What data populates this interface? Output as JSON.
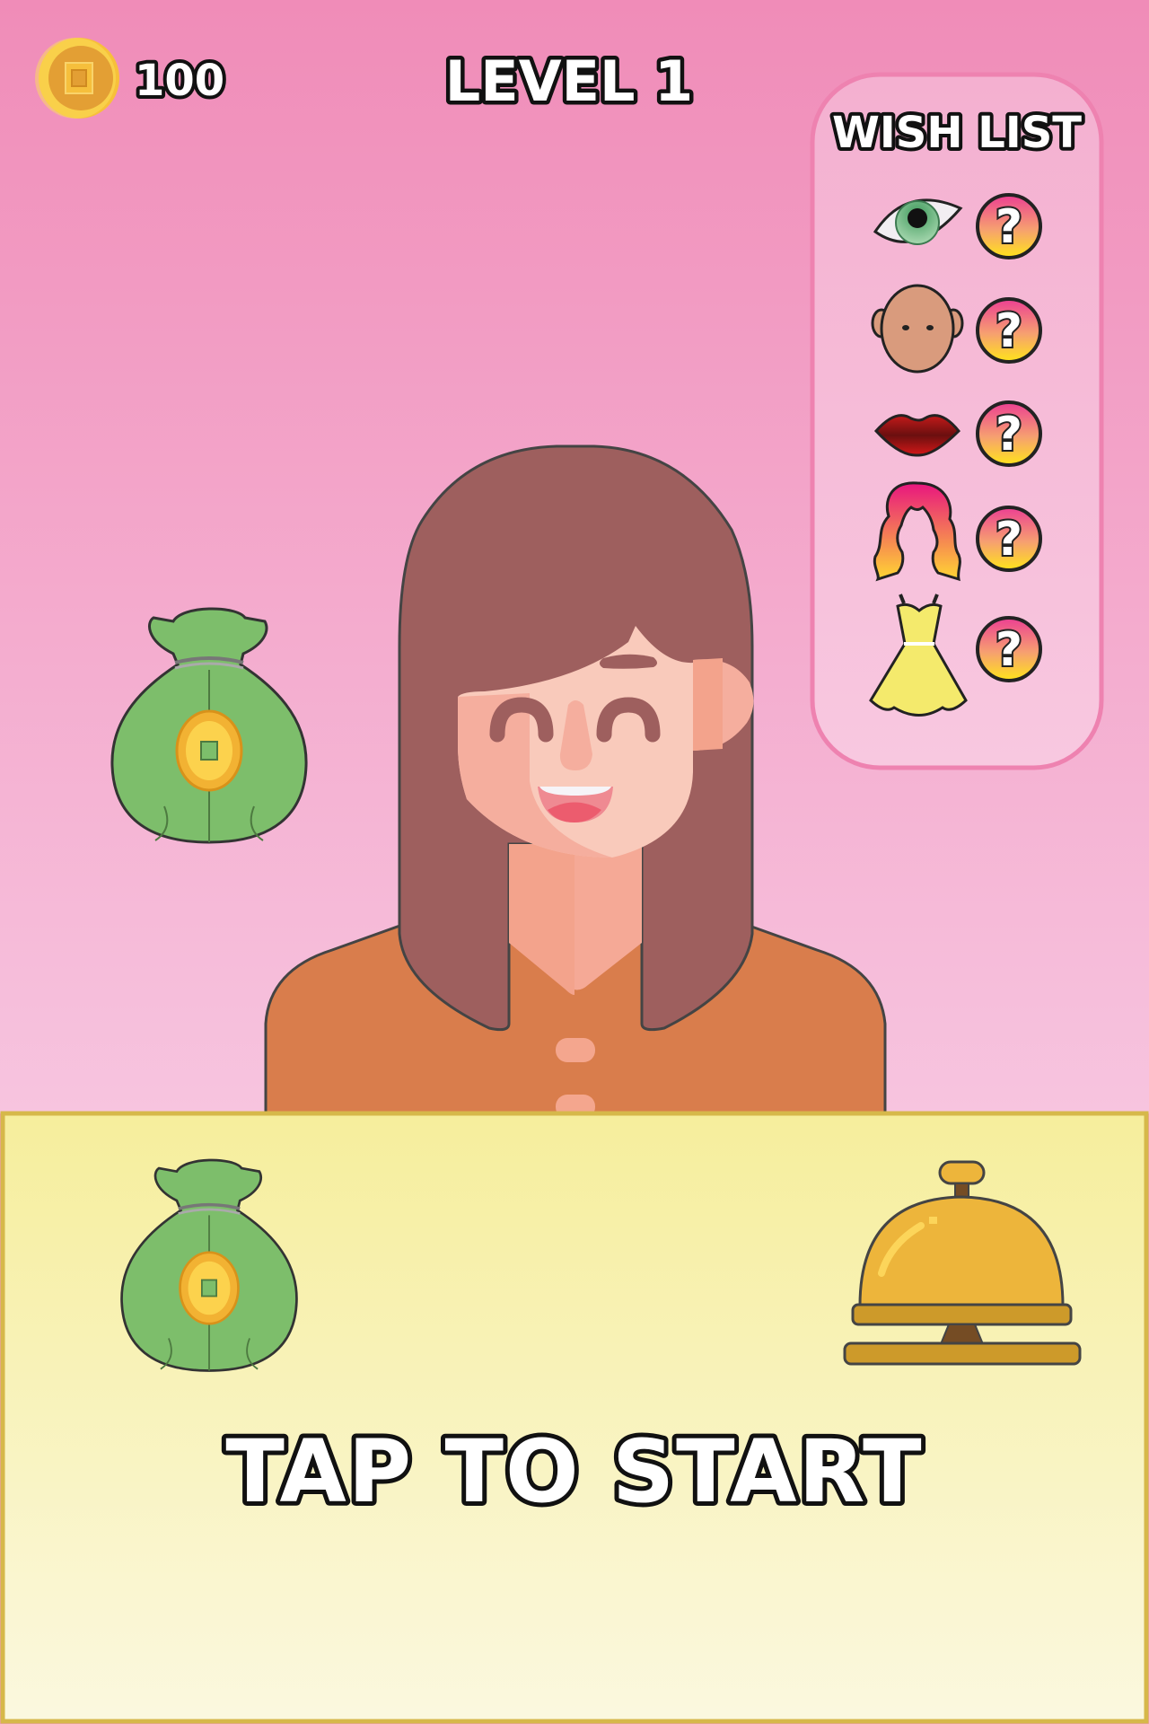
{
  "hud": {
    "coin_icon": "coin-icon",
    "coins": "100",
    "level_label": "LEVEL 1"
  },
  "wish_list": {
    "title": "WISH LIST",
    "items": [
      {
        "item": "eye",
        "icon": "eye-icon",
        "status": "?"
      },
      {
        "item": "face",
        "icon": "face-icon",
        "status": "?"
      },
      {
        "item": "lips",
        "icon": "lips-icon",
        "status": "?"
      },
      {
        "item": "hair",
        "icon": "hair-icon",
        "status": "?"
      },
      {
        "item": "dress",
        "icon": "dress-icon",
        "status": "?"
      }
    ]
  },
  "counter": {
    "prompt": "TAP TO START",
    "bell_icon": "service-bell-icon",
    "bag_icon": "money-bag-icon"
  },
  "colors": {
    "bg_top": "#f08cb8",
    "bg_bottom": "#f7c4df",
    "counter_top": "#f6ee9c",
    "counter_bottom": "#fbf8df",
    "counter_border": "#d6b84a",
    "hair": "#9e5f5e",
    "shirt": "#d97d4c",
    "skin": "#f9cabb"
  }
}
